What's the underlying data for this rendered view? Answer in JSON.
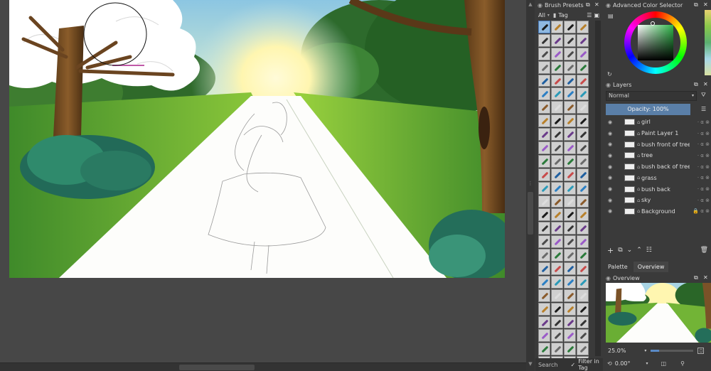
{
  "brush_presets": {
    "title": "Brush Presets",
    "tag_filter": "All",
    "tag_label": "Tag",
    "search_label": "Search",
    "filter_in_tag_label": "Filter in Tag",
    "filter_in_tag_checked": true
  },
  "color_selector": {
    "title": "Advanced Color Selector"
  },
  "layers": {
    "title": "Layers",
    "blend_mode": "Normal",
    "opacity_label": "Opacity:  100%",
    "items": [
      {
        "name": "girl"
      },
      {
        "name": "Paint Layer 1"
      },
      {
        "name": "bush front of tree"
      },
      {
        "name": "tree"
      },
      {
        "name": "bush back of tree"
      },
      {
        "name": "grass"
      },
      {
        "name": "bush back"
      },
      {
        "name": "sky"
      },
      {
        "name": "Background"
      }
    ]
  },
  "dock_tabs": {
    "palette": "Palette",
    "overview": "Overview"
  },
  "overview": {
    "title": "Overview",
    "zoom": "25.0%",
    "rotation": "0.00°"
  },
  "colors": {
    "accent": "#5a8ac6",
    "panel_bg": "#3a3a3a",
    "selected_row": "#5a7fa8"
  }
}
